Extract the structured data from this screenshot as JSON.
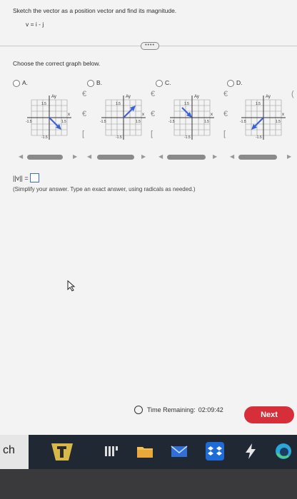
{
  "question": {
    "prompt": "Sketch the vector as a position vector and find its magnitude.",
    "equation": "v = i - j"
  },
  "divider_handle": "••••",
  "choose_text": "Choose the correct graph below.",
  "options": [
    {
      "label": "A.",
      "direction": "down-right"
    },
    {
      "label": "B.",
      "direction": "up-right"
    },
    {
      "label": "C.",
      "direction": "down-right-from-upper-left"
    },
    {
      "label": "D.",
      "direction": "down-left"
    }
  ],
  "graph_labels": {
    "y": "Ay",
    "x": "x",
    "pos": "1.5",
    "neg": "-1.5"
  },
  "answer": {
    "label": "||v|| =",
    "value": ""
  },
  "hint": "(Simplify your answer. Type an exact answer, using radicals as needed.)",
  "timer": {
    "label": "Time Remaining:",
    "value": "02:09:42"
  },
  "next_label": "Next",
  "taskbar": {
    "search_glyph": "ch"
  },
  "colors": {
    "next_bg": "#d62f3a",
    "vector": "#3a5fd9",
    "answer_border": "#3a6fc4"
  }
}
